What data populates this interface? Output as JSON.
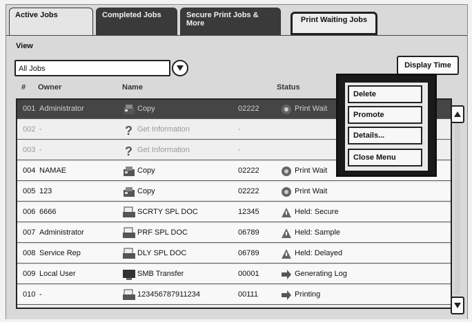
{
  "tabs": [
    {
      "label": "Active Jobs"
    },
    {
      "label": "Completed Jobs"
    },
    {
      "label": "Secure Print Jobs & More"
    },
    {
      "label": "Print Waiting Jobs"
    }
  ],
  "view": {
    "label": "View",
    "selected": "All Jobs"
  },
  "display_time_label": "Display Time",
  "columns": {
    "number": "#",
    "owner": "Owner",
    "name": "Name",
    "status": "Status"
  },
  "rows": [
    {
      "no": "001",
      "owner": "Administrator",
      "name": "Copy",
      "num": "02222",
      "status": "Print Wait",
      "icon": "copy-icon",
      "status_icon": "print-wait-icon"
    },
    {
      "no": "002",
      "owner": "-",
      "name": "Get Information",
      "num": "-",
      "status": "",
      "icon": "question-icon",
      "status_icon": ""
    },
    {
      "no": "003",
      "owner": "-",
      "name": "Get Information",
      "num": "-",
      "status": "",
      "icon": "question-icon",
      "status_icon": ""
    },
    {
      "no": "004",
      "owner": "NAMAE",
      "name": "Copy",
      "num": "02222",
      "status": "Print Wait",
      "icon": "copy-icon",
      "status_icon": "print-wait-icon"
    },
    {
      "no": "005",
      "owner": "123",
      "name": "Copy",
      "num": "02222",
      "status": "Print Wait",
      "icon": "copy-icon",
      "status_icon": "print-wait-icon"
    },
    {
      "no": "006",
      "owner": "6666",
      "name": "SCRTY SPL DOC",
      "num": "12345",
      "status": "Held: Secure",
      "icon": "printer-icon",
      "status_icon": "warning-icon"
    },
    {
      "no": "007",
      "owner": "Administrator",
      "name": "PRF SPL DOC",
      "num": "06789",
      "status": "Held: Sample",
      "icon": "printer-icon",
      "status_icon": "warning-icon"
    },
    {
      "no": "008",
      "owner": "Service Rep",
      "name": "DLY SPL DOC",
      "num": "06789",
      "status": "Held: Delayed",
      "icon": "printer-icon",
      "status_icon": "warning-icon"
    },
    {
      "no": "009",
      "owner": "Local User",
      "name": "SMB Transfer",
      "num": "00001",
      "status": "Generating Log",
      "icon": "computer-icon",
      "status_icon": "arrow-icon"
    },
    {
      "no": "010",
      "owner": "-",
      "name": "123456787911234",
      "num": "00111",
      "status": "Printing",
      "icon": "printer-icon",
      "status_icon": "arrow-icon"
    }
  ],
  "popup_menu": [
    {
      "label": "Delete"
    },
    {
      "label": "Promote"
    },
    {
      "label": "Details..."
    },
    {
      "label": "Close Menu"
    }
  ]
}
